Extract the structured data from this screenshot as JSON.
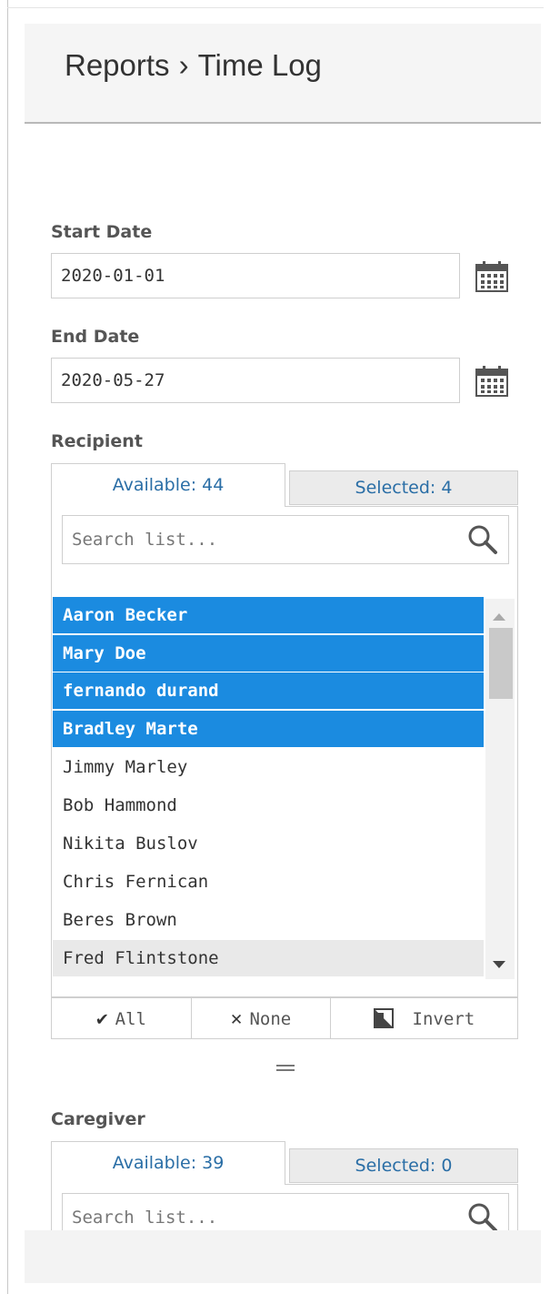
{
  "breadcrumb": {
    "section": "Reports",
    "separator": "›",
    "page": "Time Log"
  },
  "start_date": {
    "label": "Start Date",
    "value": "2020-01-01"
  },
  "end_date": {
    "label": "End Date",
    "value": "2020-05-27"
  },
  "recipient": {
    "label": "Recipient",
    "tab_available": "Available: 44",
    "tab_selected": "Selected: 4",
    "search_placeholder": "Search list...",
    "items": [
      {
        "name": "Aaron Becker",
        "state": "selected"
      },
      {
        "name": "Mary Doe",
        "state": "selected"
      },
      {
        "name": "fernando durand",
        "state": "selected"
      },
      {
        "name": "Bradley Marte",
        "state": "selected"
      },
      {
        "name": "Jimmy Marley",
        "state": "normal"
      },
      {
        "name": "Bob Hammond",
        "state": "normal"
      },
      {
        "name": "Nikita Buslov",
        "state": "normal"
      },
      {
        "name": "Chris Fernican",
        "state": "normal"
      },
      {
        "name": "Beres Brown",
        "state": "normal"
      },
      {
        "name": "Fred Flintstone",
        "state": "hover"
      }
    ],
    "actions": {
      "all": "All",
      "none": "None",
      "invert": "Invert"
    }
  },
  "caregiver": {
    "label": "Caregiver",
    "tab_available": "Available: 39",
    "tab_selected": "Selected: 0",
    "search_placeholder": "Search list..."
  },
  "colors": {
    "selected_bg": "#1b8be0",
    "link": "#2a6ea6",
    "hover_bg": "#e9e9e9"
  },
  "icons": [
    "calendar-icon",
    "search-icon",
    "checkmark-icon",
    "x-icon",
    "invert-icon",
    "scroll-up-icon",
    "scroll-down-icon"
  ]
}
